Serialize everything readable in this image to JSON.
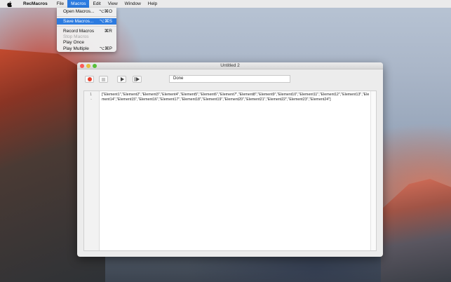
{
  "menubar": {
    "app_name": "RecMacros",
    "items": [
      "File",
      "Macros",
      "Edit",
      "View",
      "Window",
      "Help"
    ]
  },
  "dropdown": {
    "items": [
      {
        "label": "Open Macros...",
        "shortcut": "⌥⌘O"
      },
      {
        "label": "Save Macros...",
        "shortcut": "⌥⌘S"
      },
      {
        "label": "Record Macros",
        "shortcut": "⌘R"
      },
      {
        "label": "Stop Macros",
        "shortcut": ""
      },
      {
        "label": "Play Once",
        "shortcut": ""
      },
      {
        "label": "Play Multiple",
        "shortcut": "⌥⌘P"
      }
    ]
  },
  "window": {
    "title": "Untitled 2",
    "status_text": "Done"
  },
  "editor": {
    "line_number": "1",
    "line_marker": "-",
    "content": "[\"Element1\",\"Element2\",\"Element3\",\"Element4\",\"Element5\",\"Element6\",\"Element7\",\"Element8\",\"Element9\",\"Element10\",\"Element11\",\"Element12\",\"Element13\",\"Element14\",\"Element15\",\"Element16\",\"Element17\",\"Element18\",\"Element19\",\"Element20\",\"Element21\",\"Element22\",\"Element23\",\"Element24\"]"
  },
  "colors": {
    "accent": "#2c7be0",
    "record": "#e8402c",
    "close": "#fc5b57",
    "minimize": "#e5bf3c",
    "maximize": "#57c038"
  }
}
